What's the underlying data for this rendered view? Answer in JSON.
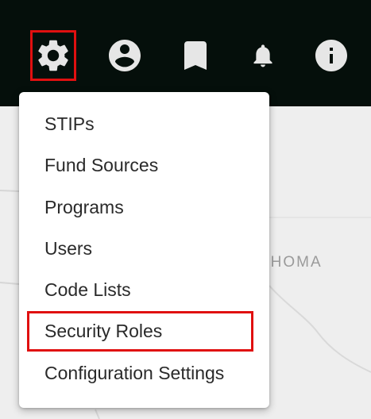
{
  "toolbar": {
    "icons": [
      {
        "name": "gear-icon",
        "highlighted": true
      },
      {
        "name": "account-circle-icon",
        "highlighted": false
      },
      {
        "name": "bookmark-icon",
        "highlighted": false
      },
      {
        "name": "bell-icon",
        "highlighted": false
      },
      {
        "name": "info-icon",
        "highlighted": false
      }
    ]
  },
  "map": {
    "label": "AHOMA"
  },
  "menu": {
    "items": [
      {
        "label": "STIPs"
      },
      {
        "label": "Fund Sources"
      },
      {
        "label": "Programs"
      },
      {
        "label": "Users"
      },
      {
        "label": "Code Lists"
      },
      {
        "label": "Security Roles",
        "highlighted": true
      },
      {
        "label": "Configuration Settings"
      }
    ]
  },
  "colors": {
    "topbar": "#050f0b",
    "icon": "#e6e6e6",
    "highlight": "#e01010",
    "menu_background": "#ffffff",
    "map_background": "#eeeeee"
  }
}
